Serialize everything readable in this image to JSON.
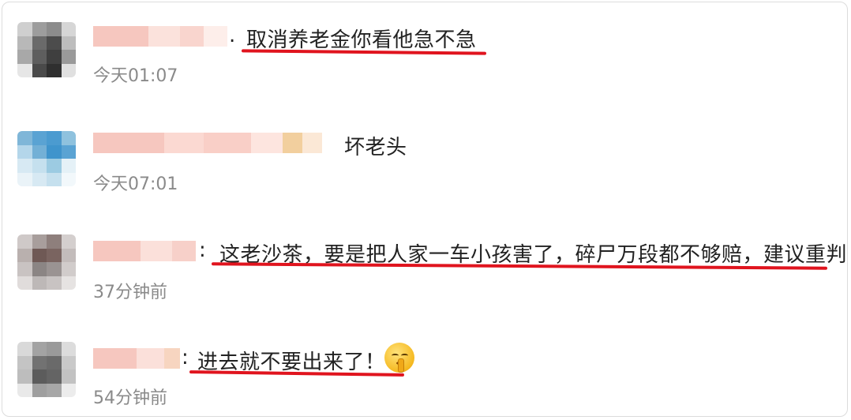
{
  "comments": [
    {
      "separator": ".",
      "text": "取消养老金你看他急不急",
      "time": "今天01:07"
    },
    {
      "separator": "",
      "text": "坏老头",
      "time": "今天07:01"
    },
    {
      "separator": ":",
      "text": "这老沙茶，要是把人家一车小孩害了，碎尸万段都不够赔，建议重判",
      "time": "37分钟前"
    },
    {
      "separator": ":",
      "text": "进去就不要出来了！",
      "time": "54分钟前",
      "emoji": "shushing-face-emoji"
    }
  ],
  "colors": {
    "underline": "#e0141e",
    "time": "#8a8a8a",
    "text": "#222222"
  }
}
